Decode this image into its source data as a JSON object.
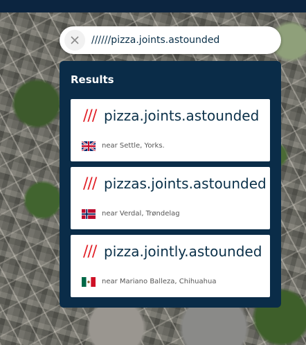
{
  "search": {
    "value": "//////pizza.joints.astounded",
    "clear_icon": "close-icon"
  },
  "results": {
    "title": "Results",
    "items": [
      {
        "prefix": "///",
        "words": "pizza.joints.astounded",
        "near": "near Settle, Yorks.",
        "flag_icon": "uk-flag-icon"
      },
      {
        "prefix": "///",
        "words": "pizzas.joints.astounded",
        "near": "near Verdal, Trøndelag",
        "flag_icon": "norway-flag-icon"
      },
      {
        "prefix": "///",
        "words": "pizza.jointly.astounded",
        "near": "near Mariano Balleza, Chihuahua",
        "flag_icon": "mexico-flag-icon"
      }
    ]
  },
  "colors": {
    "top_bar": "#0c2540",
    "panel": "#0a2c48",
    "accent_slashes": "#e11f26",
    "word_text": "#0a3049"
  }
}
